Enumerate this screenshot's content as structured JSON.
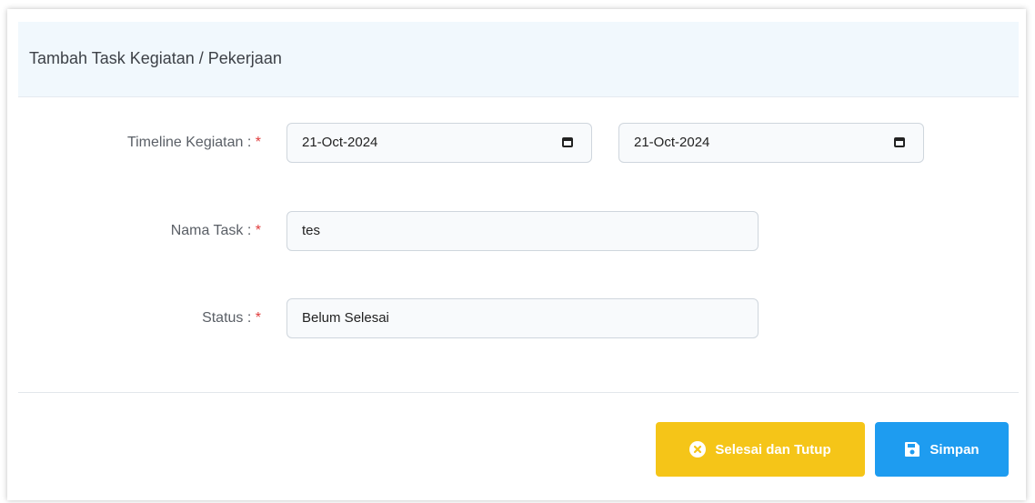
{
  "header": {
    "title": "Tambah Task Kegiatan / Pekerjaan"
  },
  "form": {
    "timeline": {
      "label": "Timeline Kegiatan :",
      "required_mark": "*",
      "start_value": "21-Oct-2024",
      "end_value": "21-Oct-2024"
    },
    "task_name": {
      "label": "Nama Task :",
      "required_mark": "*",
      "value": "tes"
    },
    "status": {
      "label": "Status :",
      "required_mark": "*",
      "value": "Belum Selesai"
    }
  },
  "footer": {
    "close_button": {
      "label": "Selesai dan Tutup",
      "icon": "close-circle-icon",
      "color": "#f5c518"
    },
    "save_button": {
      "label": "Simpan",
      "icon": "save-icon",
      "color": "#1e9cf0"
    }
  }
}
